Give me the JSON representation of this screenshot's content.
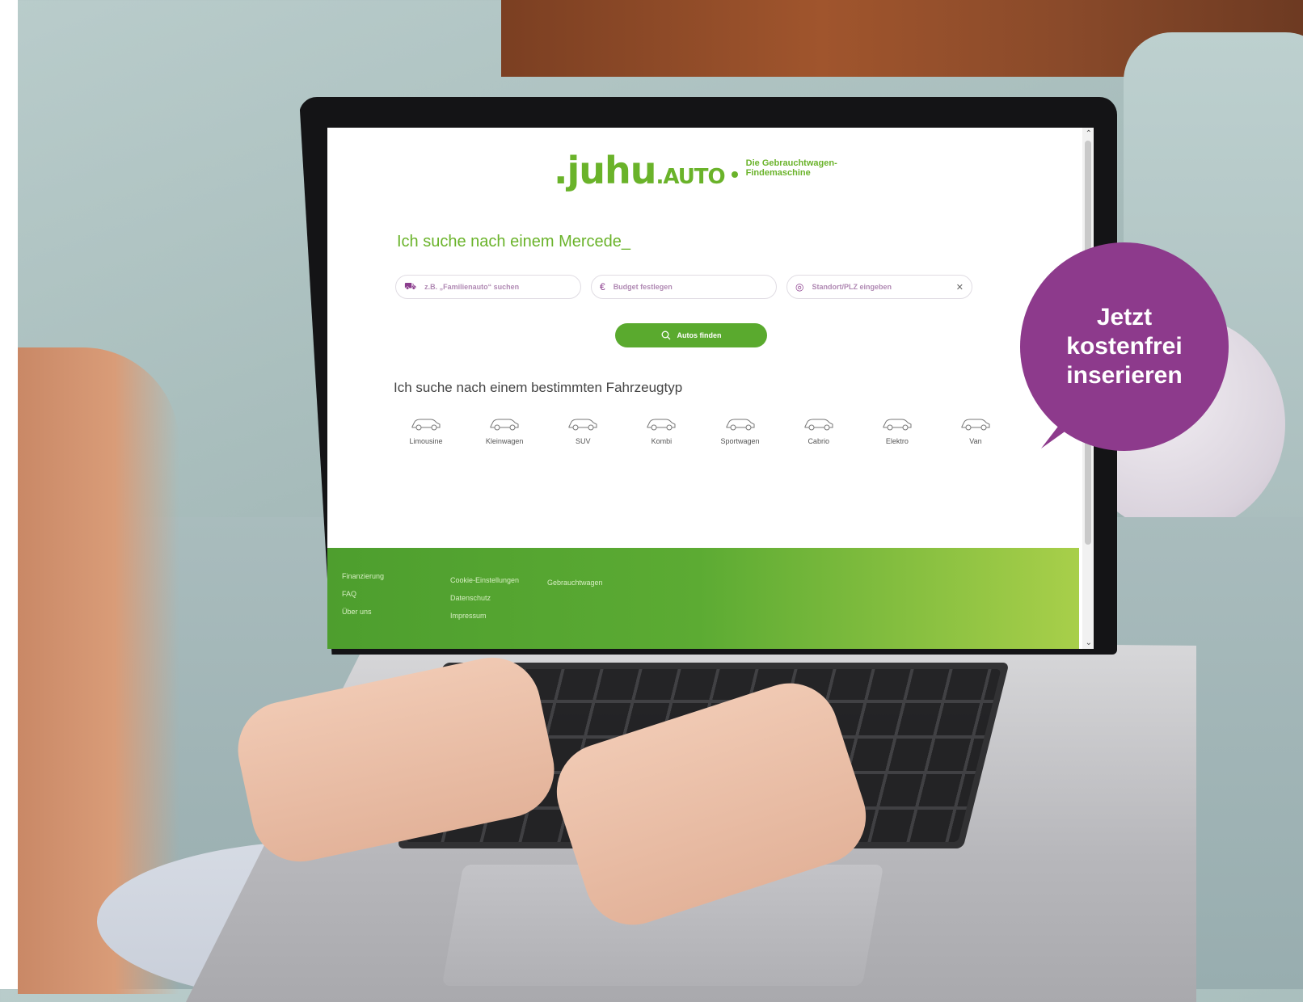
{
  "site": {
    "logo": {
      "mark": ".juhu",
      "suffix": ".AUTO",
      "claim_line1": "Die Gebrauchtwagen-",
      "claim_line2": "Findemaschine"
    },
    "headline": "Ich suche nach einem Mercede_",
    "search": {
      "query_placeholder": "z.B. „Familienauto“ suchen",
      "budget_placeholder": "Budget festlegen",
      "location_placeholder": "Standort/PLZ eingeben",
      "button_label": "Autos finden"
    },
    "vehicle_types_heading": "Ich suche nach einem bestimmten Fahrzeugtyp",
    "vehicle_types": [
      "Limousine",
      "Kleinwagen",
      "SUV",
      "Kombi",
      "Sportwagen",
      "Cabrio",
      "Elektro",
      "Van"
    ],
    "footer": {
      "col1": [
        "Finanzierung",
        "FAQ",
        "Über uns"
      ],
      "col2": [
        "Cookie-Einstellungen",
        "Datenschutz",
        "Impressum"
      ],
      "col3": [
        "Gebrauchtwagen"
      ]
    }
  },
  "bubble": {
    "line1": "Jetzt",
    "line2": "kostenfrei",
    "line3": "inserieren"
  },
  "colors": {
    "brand_green": "#6ab32a",
    "bubble_purple": "#8d3a8c",
    "accent_purple": "#8b3d8d"
  },
  "icons": [
    "car-icon",
    "euro-icon",
    "location-pin-icon",
    "close-icon",
    "search-icon",
    "chevron-up-icon",
    "chevron-down-icon"
  ]
}
